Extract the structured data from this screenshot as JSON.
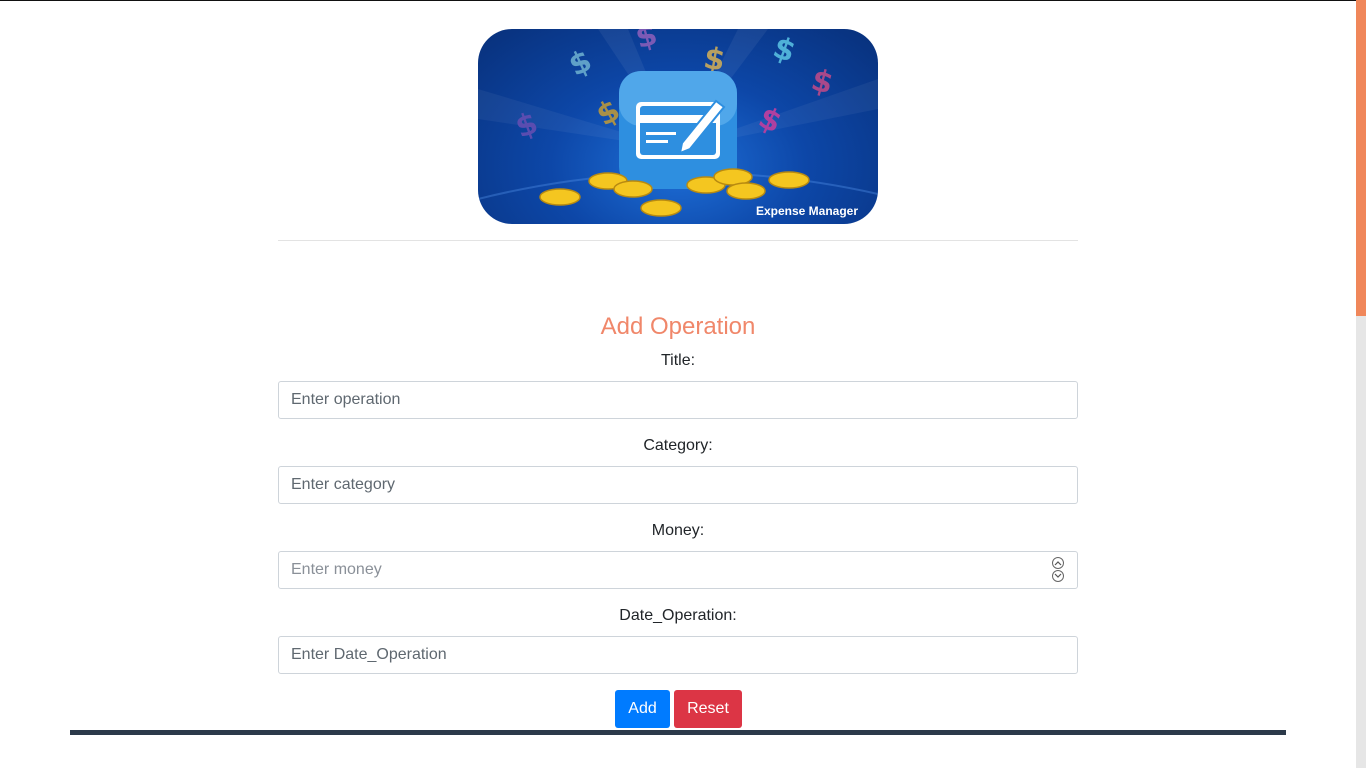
{
  "logo": {
    "caption": "Expense Manager",
    "icon": "credit-card-pen-icon"
  },
  "form": {
    "title": "Add Operation",
    "fields": [
      {
        "label": "Title:",
        "placeholder": "Enter operation"
      },
      {
        "label": "Category:",
        "placeholder": "Enter category"
      },
      {
        "label": "Money:",
        "placeholder": "Enter money"
      },
      {
        "label": "Date_Operation:",
        "placeholder": "Enter Date_Operation"
      }
    ],
    "add_label": "Add",
    "reset_label": "Reset"
  },
  "colors": {
    "title": "#f0876a",
    "add": "#007bff",
    "reset": "#dc3545",
    "footer": "#2c3a4a",
    "scroll_thumb": "#f0875a"
  }
}
